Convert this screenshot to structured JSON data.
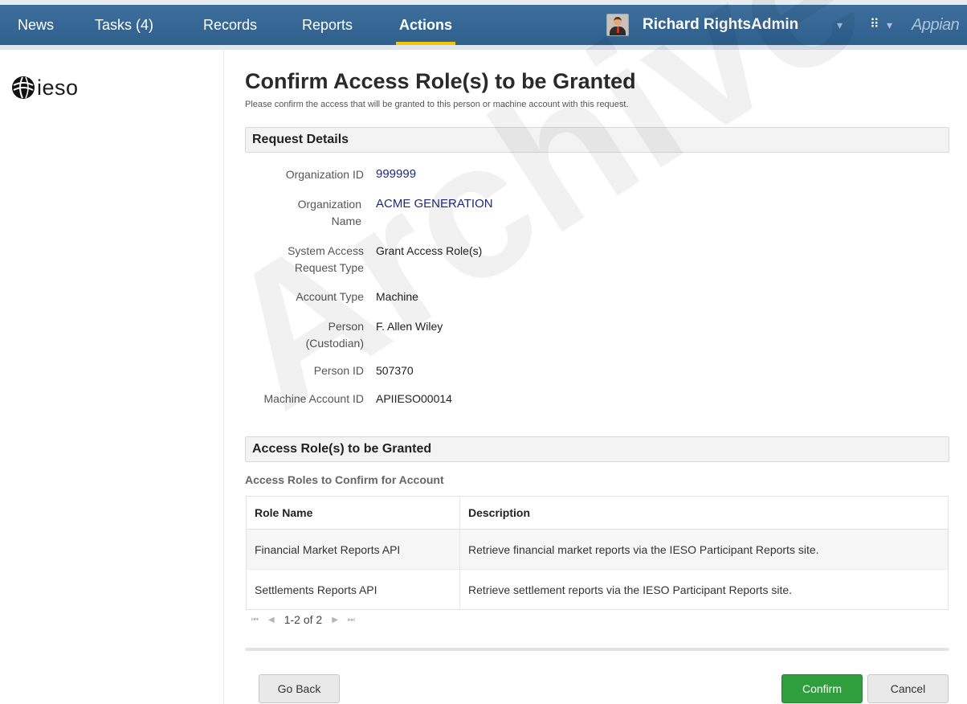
{
  "nav": {
    "items": [
      {
        "label": "News"
      },
      {
        "label": "Tasks (4)"
      },
      {
        "label": "Records"
      },
      {
        "label": "Reports"
      },
      {
        "label": "Actions"
      }
    ],
    "active_item": "Actions",
    "user_name": "Richard RightsAdmin",
    "caret": "▾",
    "apps_icon_glyph": "⠿",
    "brand": "Appian",
    "accent_color": "#f5c400",
    "bar_color": "#2e5f8d"
  },
  "sidebar": {
    "logo_text": "ieso"
  },
  "page": {
    "title": "Confirm Access Role(s) to be Granted",
    "subtitle": "Please confirm the access that will be granted to this person or machine account with this request."
  },
  "request_details": {
    "header": "Request Details",
    "fields": [
      {
        "label": "Organization ID",
        "value": "999999"
      },
      {
        "label": "Organization Name",
        "value": "ACME GENERATION"
      },
      {
        "label": "System Access Request Type",
        "value": "Grant Access Role(s)"
      },
      {
        "label": "Account Type",
        "value": "Machine"
      },
      {
        "label": "Person (Custodian)",
        "value": "F. Allen Wiley"
      },
      {
        "label": "Person ID",
        "value": "507370"
      },
      {
        "label": "Machine Account ID",
        "value": "APIIESO00014"
      }
    ]
  },
  "access_roles": {
    "header": "Access Role(s) to be Granted",
    "caption": "Access Roles to Confirm for Account",
    "columns": [
      "Role Name",
      "Description"
    ],
    "rows": [
      {
        "role": "Financial Market Reports API",
        "description": "Retrieve financial market reports via the IESO Participant Reports site."
      },
      {
        "role": "Settlements Reports API",
        "description": "Retrieve settlement reports via the IESO Participant Reports site."
      }
    ],
    "pager": {
      "text": "1-2 of 2",
      "first": "⏮",
      "prev": "◀",
      "next": "▶",
      "last": "⏭"
    }
  },
  "buttons": {
    "go_back": "Go Back",
    "confirm": "Confirm",
    "cancel": "Cancel",
    "confirm_color": "#2f9e3d"
  },
  "watermark": "Archive"
}
